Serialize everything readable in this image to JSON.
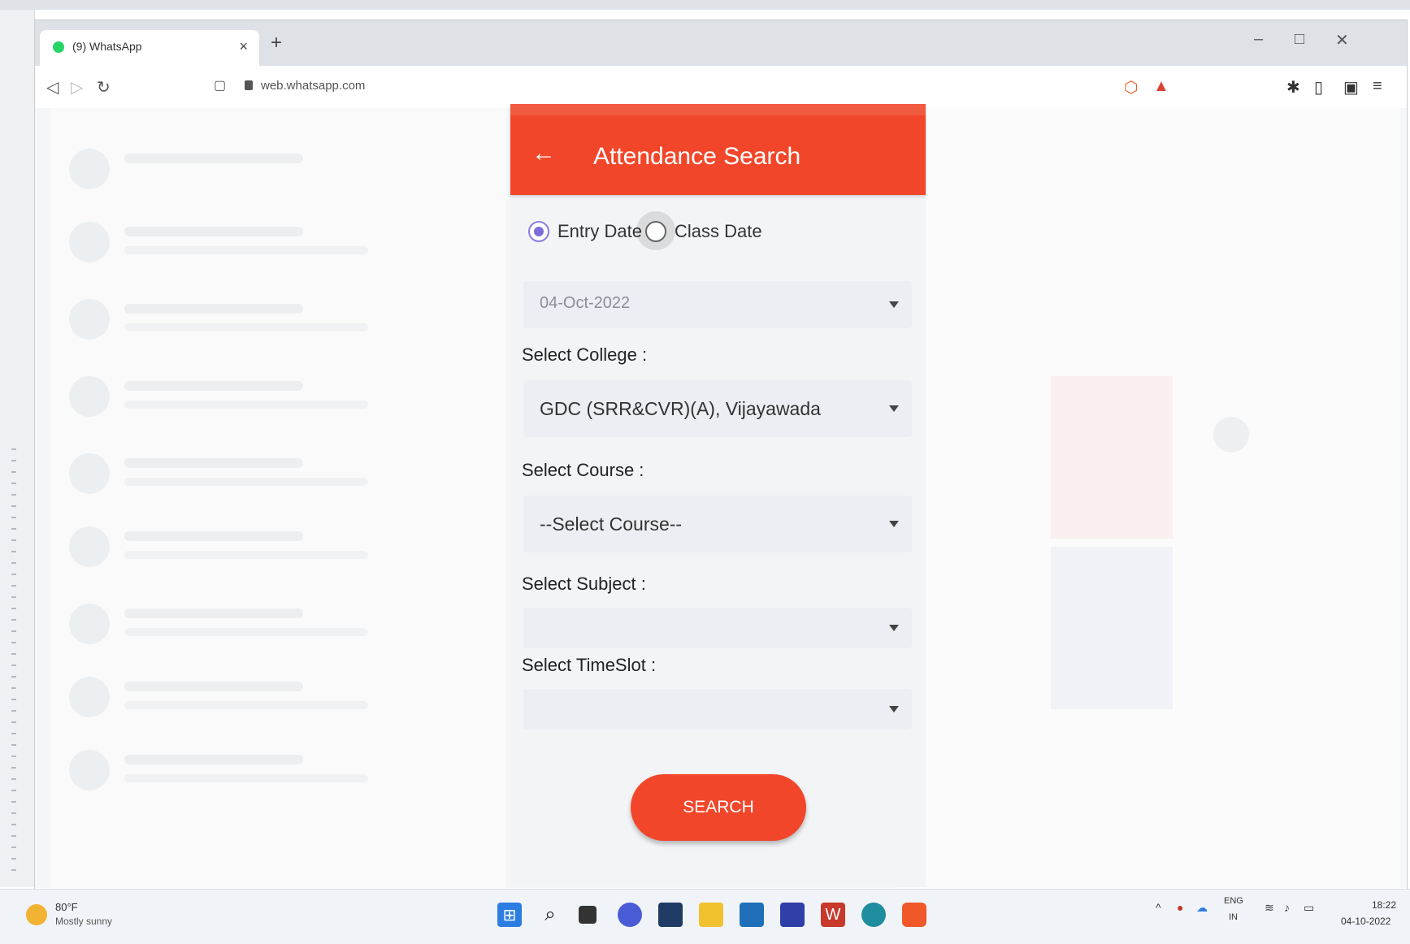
{
  "browser": {
    "tab_title": "(9) WhatsApp",
    "tab_close": "×",
    "new_tab": "+",
    "url": "web.whatsapp.com",
    "minimize": "–",
    "maximize": "□",
    "close": "✕"
  },
  "app": {
    "title": "Attendance Search",
    "back_glyph": "←",
    "radio_entry": "Entry Date",
    "radio_class": "Class Date",
    "date_value": "04-Oct-2022",
    "college_label": "Select College :",
    "college_value": "GDC (SRR&CVR)(A), Vijayawada",
    "course_label": "Select Course :",
    "course_value": "--Select Course--",
    "subject_label": "Select Subject :",
    "subject_value": "",
    "timeslot_label": "Select TimeSlot :",
    "timeslot_value": "",
    "search_label": "SEARCH",
    "selected_radio": "Entry Date",
    "accent": "#f2462a"
  },
  "taskbar": {
    "temp": "80°F",
    "weather": "Mostly sunny",
    "lang": "ENG",
    "region": "IN",
    "time": "18:22",
    "date": "04-10-2022"
  }
}
